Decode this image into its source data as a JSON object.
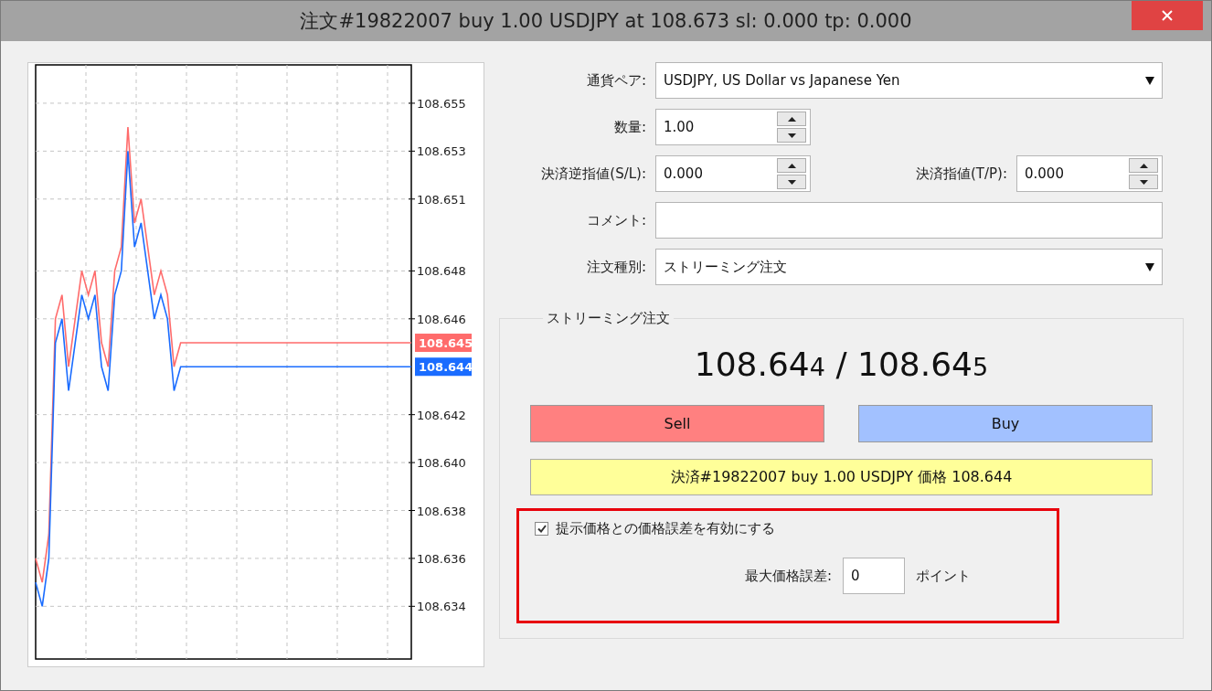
{
  "window": {
    "title": "注文#19822007 buy 1.00 USDJPY at 108.673 sl: 0.000 tp: 0.000"
  },
  "chart": {
    "price_tags": [
      {
        "text": "108.645",
        "color": "#ff6b6b"
      },
      {
        "text": "108.644",
        "color": "#1a6cff"
      }
    ],
    "chart_data": {
      "type": "line",
      "grid": true,
      "categories": [
        null,
        null,
        null,
        null,
        null,
        null,
        null,
        null,
        null,
        null,
        null,
        null,
        null,
        null,
        null,
        null,
        null,
        null,
        null,
        null,
        null,
        null,
        null,
        null,
        null,
        null,
        null,
        null,
        null,
        null,
        null,
        null,
        null,
        null,
        null,
        null,
        null,
        null,
        null,
        null,
        null,
        null,
        null,
        null,
        null,
        null,
        null,
        null,
        null,
        null,
        null,
        null,
        null,
        null,
        null,
        null,
        null,
        null
      ],
      "series": [
        {
          "color": "#ff6b6b",
          "values": [
            108.636,
            108.635,
            108.637,
            108.646,
            108.647,
            108.644,
            108.646,
            108.648,
            108.647,
            108.648,
            108.645,
            108.644,
            108.648,
            108.649,
            108.654,
            108.65,
            108.651,
            108.649,
            108.647,
            108.648,
            108.647,
            108.644,
            108.645,
            108.645,
            108.645,
            108.645,
            108.645,
            108.645,
            108.645,
            108.645,
            108.645,
            108.645,
            108.645,
            108.645,
            108.645,
            108.645,
            108.645,
            108.645,
            108.645,
            108.645,
            108.645,
            108.645,
            108.645,
            108.645,
            108.645,
            108.645,
            108.645,
            108.645,
            108.645,
            108.645,
            108.645,
            108.645,
            108.645,
            108.645,
            108.645,
            108.645,
            108.645,
            108.645
          ]
        },
        {
          "color": "#1a6cff",
          "values": [
            108.635,
            108.634,
            108.636,
            108.645,
            108.646,
            108.643,
            108.645,
            108.647,
            108.646,
            108.647,
            108.644,
            108.643,
            108.647,
            108.648,
            108.653,
            108.649,
            108.65,
            108.648,
            108.646,
            108.647,
            108.646,
            108.643,
            108.644,
            108.644,
            108.644,
            108.644,
            108.644,
            108.644,
            108.644,
            108.644,
            108.644,
            108.644,
            108.644,
            108.644,
            108.644,
            108.644,
            108.644,
            108.644,
            108.644,
            108.644,
            108.644,
            108.644,
            108.644,
            108.644,
            108.644,
            108.644,
            108.644,
            108.644,
            108.644,
            108.644,
            108.644,
            108.644,
            108.644,
            108.644,
            108.644,
            108.644,
            108.644,
            108.644
          ]
        }
      ],
      "ylim": [
        108.6318,
        108.6566
      ],
      "yticks": [
        {
          "value": 108.655,
          "label": "108.655"
        },
        {
          "value": 108.653,
          "label": "108.653"
        },
        {
          "value": 108.651,
          "label": "108.651"
        },
        {
          "value": 108.648,
          "label": "108.648"
        },
        {
          "value": 108.646,
          "label": "108.646"
        },
        {
          "value": 108.642,
          "label": "108.642"
        },
        {
          "value": 108.64,
          "label": "108.640"
        },
        {
          "value": 108.638,
          "label": "108.638"
        },
        {
          "value": 108.636,
          "label": "108.636"
        },
        {
          "value": 108.634,
          "label": "108.634"
        }
      ]
    }
  },
  "form": {
    "rows": [
      {
        "kind": "select",
        "label": "通貨ペア:",
        "value": "USDJPY, US Dollar vs Japanese Yen"
      },
      {
        "kind": "spin",
        "label": "数量:",
        "value": "1.00"
      },
      {
        "kind": "pair",
        "label": "決済逆指値(S/L):",
        "value": "0.000",
        "label2": "決済指値(T/P):",
        "value2": "0.000"
      },
      {
        "kind": "text",
        "label": "コメント:",
        "value": ""
      },
      {
        "kind": "select",
        "label": "注文種別:",
        "value": "ストリーミング注文"
      }
    ]
  },
  "streaming": {
    "title": "ストリーミング注文",
    "bid": {
      "main": "108.64",
      "pip": "4"
    },
    "separator": "/",
    "ask": {
      "main": "108.64",
      "pip": "5"
    },
    "sell_label": "Sell",
    "buy_label": "Buy",
    "close_label": "決済#19822007 buy 1.00 USDJPY 価格 108.644",
    "deviation": {
      "checked": true,
      "label": "提示価格との価格誤差を有効にする",
      "max_label": "最大価格誤差:",
      "max_value": "0",
      "unit": "ポイント"
    }
  }
}
